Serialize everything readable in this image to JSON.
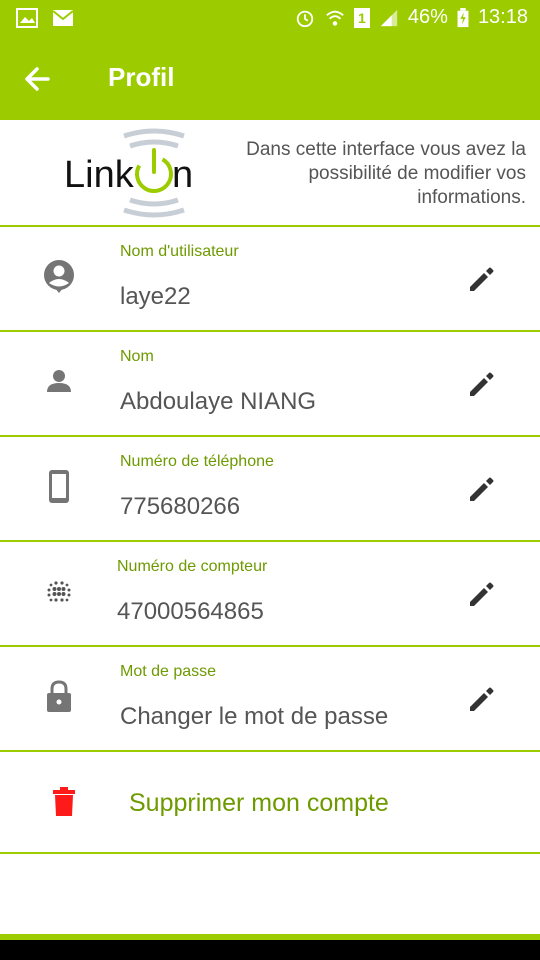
{
  "statusbar": {
    "battery": "46%",
    "time": "13:18",
    "sim_slot": "1"
  },
  "appbar": {
    "title": "Profil"
  },
  "header": {
    "logo_text_left": "Link",
    "logo_text_right": "n",
    "description": "Dans cette interface vous avez la possibilité de modifier vos informations."
  },
  "fields": [
    {
      "label": "Nom d'utilisateur",
      "value": "laye22",
      "icon": "account-circle-icon"
    },
    {
      "label": "Nom",
      "value": "Abdoulaye NIANG",
      "icon": "person-icon"
    },
    {
      "label": "Numéro de téléphone",
      "value": "775680266",
      "icon": "phone-icon"
    },
    {
      "label": "Numéro de compteur",
      "value": "47000564865",
      "icon": "meter-dots-icon"
    },
    {
      "label": "Mot de passe",
      "value": "Changer le mot de passe",
      "icon": "lock-icon"
    }
  ],
  "delete_account": {
    "label": "Supprimer mon compte",
    "icon": "trash-icon"
  },
  "colors": {
    "primary": "#9ccc00",
    "accent_text": "#6e9a00",
    "danger": "#ff1a1a"
  }
}
